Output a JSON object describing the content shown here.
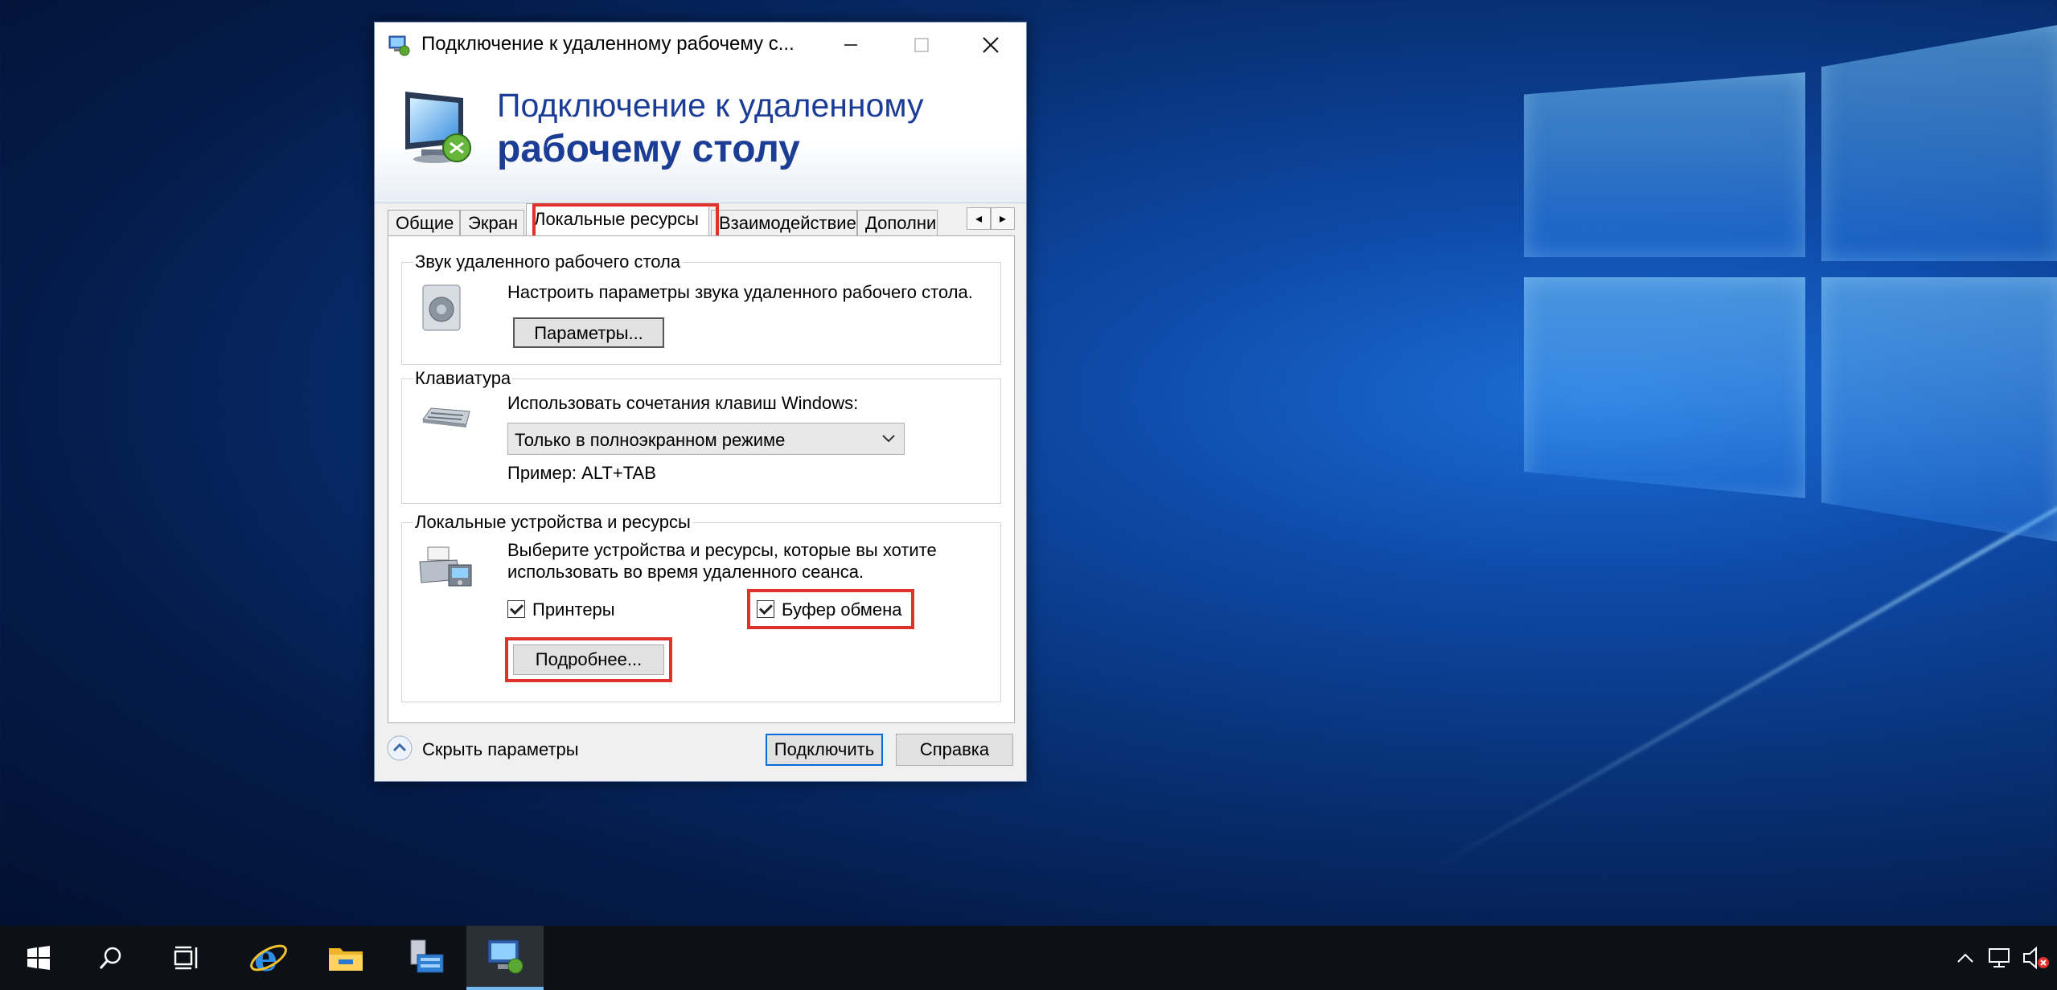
{
  "window": {
    "title": "Подключение к удаленному рабочему с...",
    "banner_line1": "Подключение к удаленному",
    "banner_line2": "рабочему столу"
  },
  "tabs": [
    {
      "label": "Общие",
      "selected": false
    },
    {
      "label": "Экран",
      "selected": false
    },
    {
      "label": "Локальные ресурсы",
      "selected": true
    },
    {
      "label": "Взаимодействие",
      "selected": false
    },
    {
      "label": "Дополни",
      "selected": false
    }
  ],
  "sound_group": {
    "title": "Звук удаленного рабочего стола",
    "description": "Настроить параметры звука удаленного рабочего стола.",
    "button": "Параметры..."
  },
  "keyboard_group": {
    "title": "Клавиатура",
    "label": "Использовать сочетания клавиш Windows:",
    "selected_option": "Только в полноэкранном режиме",
    "example": "Пример: ALT+TAB"
  },
  "devices_group": {
    "title": "Локальные устройства и ресурсы",
    "description_line1": "Выберите устройства и ресурсы, которые вы хотите",
    "description_line2": "использовать во время удаленного сеанса.",
    "printers_label": "Принтеры",
    "printers_checked": true,
    "clipboard_label": "Буфер обмена",
    "clipboard_checked": true,
    "more_button": "Подробнее..."
  },
  "footer": {
    "hide_options": "Скрыть параметры",
    "connect": "Подключить",
    "help": "Справка"
  },
  "highlight_color": "#e0312b",
  "taskbar": {
    "icons": [
      "windows-start-icon",
      "search-icon",
      "task-view-icon",
      "internet-explorer-icon",
      "file-explorer-icon",
      "server-manager-icon",
      "remote-desktop-icon"
    ],
    "active": "remote-desktop-icon",
    "tray": [
      "chevron-up-icon",
      "network-icon",
      "volume-muted-icon"
    ]
  }
}
